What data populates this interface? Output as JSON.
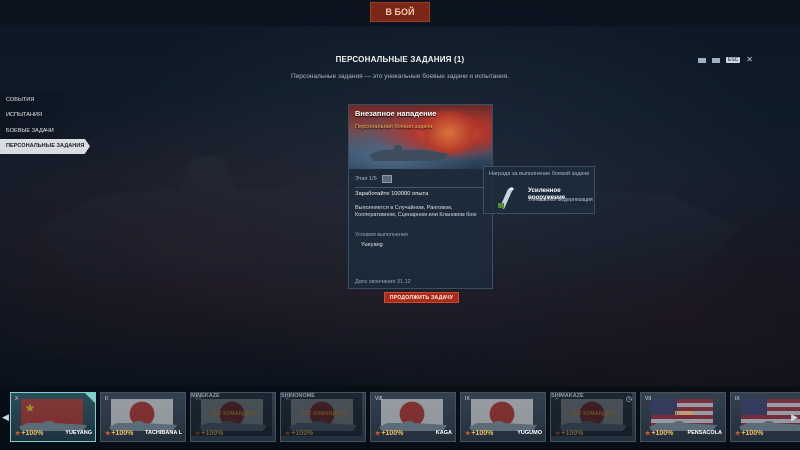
{
  "topbar": {
    "left": "",
    "battle_label": "В БОЙ",
    "mode_left": "",
    "mode_right": "",
    "right": ""
  },
  "header": {
    "title": "ПЕРСОНАЛЬНЫЕ ЗАДАНИЯ (1)",
    "subtitle": "Персональные задания — это уникальные боевые задачи и испытания.",
    "esc_label": "ESC"
  },
  "sidebar": {
    "items": [
      {
        "label": "СОБЫТИЯ"
      },
      {
        "label": "ИСПЫТАНИЯ"
      },
      {
        "label": "БОЕВЫЕ ЗАДАЧИ"
      },
      {
        "label": "ПЕРСОНАЛЬНЫЕ ЗАДАНИЯ",
        "active": true
      }
    ]
  },
  "mission": {
    "title": "Внезапное нападение",
    "type": "Персональная боевая задача",
    "stage": "Этап 1/5",
    "task": "Заработайте 100000 опыта",
    "description": "Выполняется в Случайном, Ранговом, Кооперативном, Сценарном или Клановом бою",
    "conditions_label": "Условия выполнения",
    "conditions_value": "Yueyang",
    "end_date": "Дата окончания 31.12",
    "continue_label": "ПРОДОЛЖИТЬ ЗАДАЧУ"
  },
  "reward": {
    "label": "Награда за выполнение боевой задачи",
    "name": "Усиленное вооружение",
    "type": "Уникальная модернизация",
    "icon": "upgrade-module-icon"
  },
  "carousel": {
    "ships": [
      {
        "name": "YUEYANG",
        "tier": "X",
        "xp": "+100%",
        "flag": "cn",
        "selected": true,
        "warning": ""
      },
      {
        "name": "TACHIBANA L",
        "tier": "II",
        "xp": "+100%",
        "flag": "jp",
        "warning": ""
      },
      {
        "name": "MINEKAZE",
        "tier": "VII",
        "xp": "+100%",
        "flag": "jp",
        "warning": "НЕТ КОМАНДИРА",
        "dim": true
      },
      {
        "name": "SHINONOME",
        "tier": "VI",
        "xp": "+100%",
        "flag": "jp",
        "warning": "НЕТ КОМАНДИРА",
        "dim": true
      },
      {
        "name": "KAGA",
        "tier": "VIII",
        "xp": "+100%",
        "flag": "jp",
        "warning": ""
      },
      {
        "name": "YUGUMO",
        "tier": "IX",
        "xp": "+100%",
        "flag": "jp",
        "warning": ""
      },
      {
        "name": "SHIMAKAZE",
        "tier": "X",
        "xp": "+100%",
        "flag": "jp",
        "warning": "НЕТ КОМАНДИРА",
        "dim": true,
        "clock": true
      },
      {
        "name": "PENSACOLA",
        "tier": "VII",
        "xp": "+100%",
        "flag": "us",
        "warning": "В БОЮ"
      },
      {
        "name": "",
        "tier": "IX",
        "xp": "+100%",
        "flag": "us",
        "warning": ""
      }
    ]
  }
}
